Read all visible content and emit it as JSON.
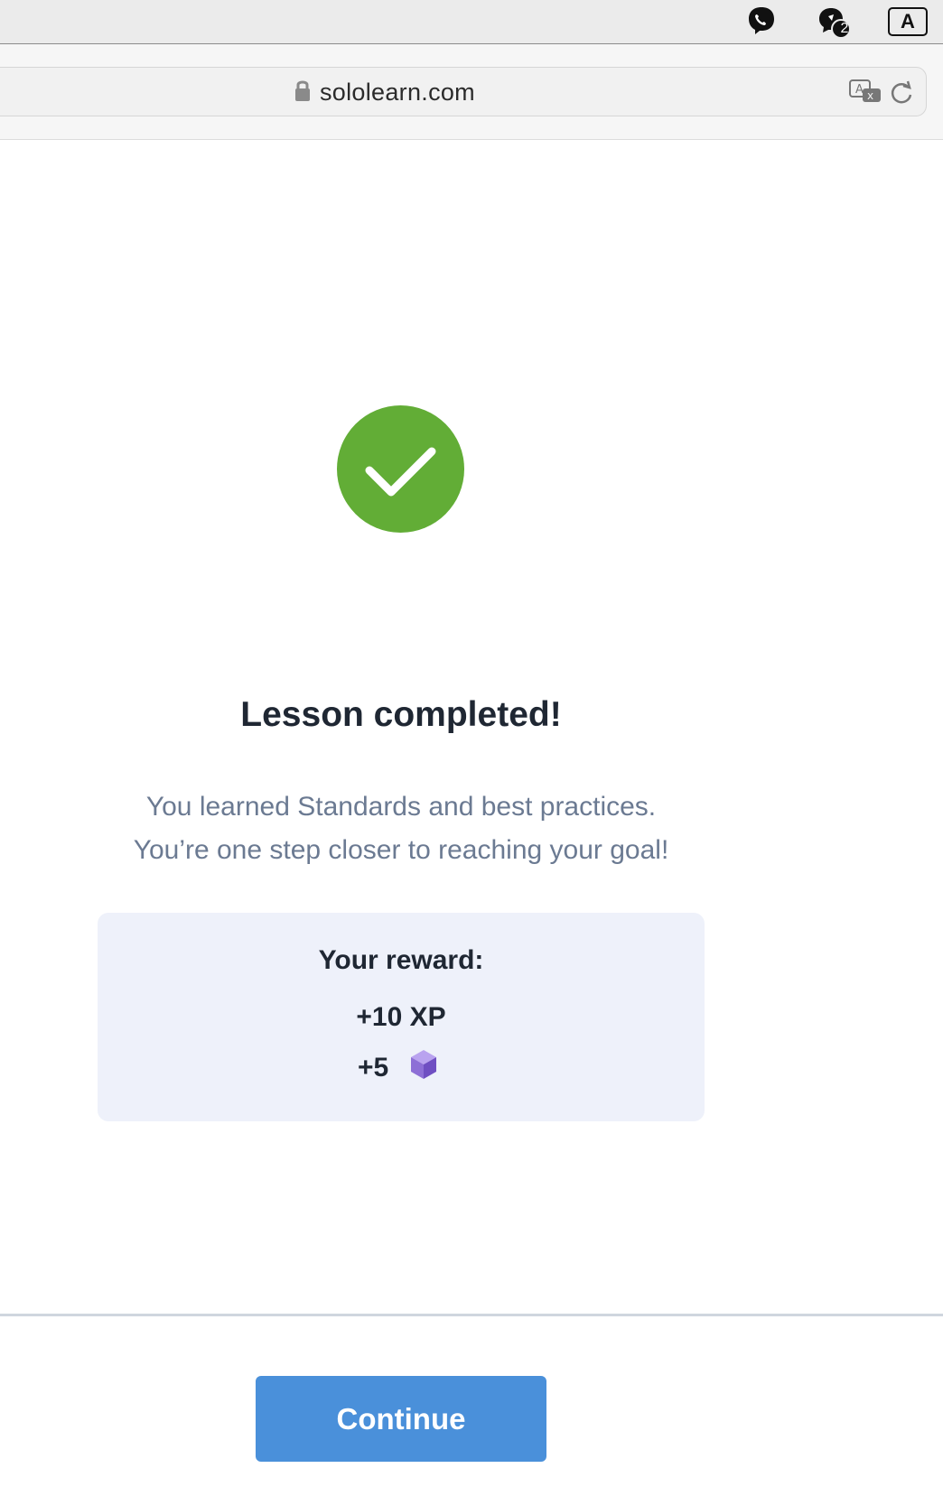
{
  "menubar": {
    "icons": [
      "viber-icon",
      "chat-notification-icon",
      "input-source-icon"
    ],
    "notification_count": "2",
    "input_source_label": "A"
  },
  "browser": {
    "url": "sololearn.com"
  },
  "lesson": {
    "title": "Lesson completed!",
    "description_line1": "You learned Standards and best practices.",
    "description_line2": "You’re one step closer to reaching your goal!",
    "reward_title": "Your reward:",
    "reward_xp": "+10 XP",
    "reward_bits": "+5"
  },
  "footer": {
    "continue_label": "Continue"
  },
  "colors": {
    "success": "#62ad36",
    "primary_button": "#4a90da",
    "reward_background": "#eef1fa",
    "bit_icon": "#8d6fd6"
  }
}
